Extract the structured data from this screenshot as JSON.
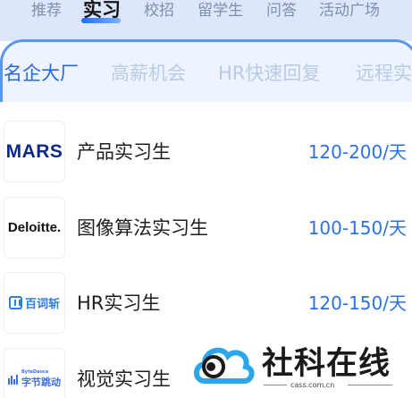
{
  "top_tabs": [
    {
      "label": "推荐",
      "active": false
    },
    {
      "label": "实习",
      "active": true
    },
    {
      "label": "校招",
      "active": false
    },
    {
      "label": "留学生",
      "active": false
    },
    {
      "label": "问答",
      "active": false
    },
    {
      "label": "活动广场",
      "active": false
    }
  ],
  "sub_tabs": [
    {
      "label": "名企大厂",
      "active": true
    },
    {
      "label": "高薪机会",
      "active": false
    },
    {
      "label": "HR快速回复",
      "active": false
    },
    {
      "label": "远程实",
      "active": false
    }
  ],
  "jobs": [
    {
      "logo": "MARS",
      "title": "产品实习生",
      "salary": "120-200/天"
    },
    {
      "logo": "Deloitte.",
      "title": "图像算法实习生",
      "salary": "100-150/天"
    },
    {
      "logo": "百词斩",
      "title": "HR实习生",
      "salary": "120-150/天"
    },
    {
      "logo": "字节跳动",
      "logo_small": "ByteDance",
      "title": "视觉实习生",
      "salary": ""
    }
  ],
  "watermark": {
    "name": "社科在线",
    "domain": "cass.com.cn"
  },
  "colors": {
    "accent": "#2a6ad8",
    "salary": "#2b72e8",
    "card_border": "#5a95ee"
  }
}
